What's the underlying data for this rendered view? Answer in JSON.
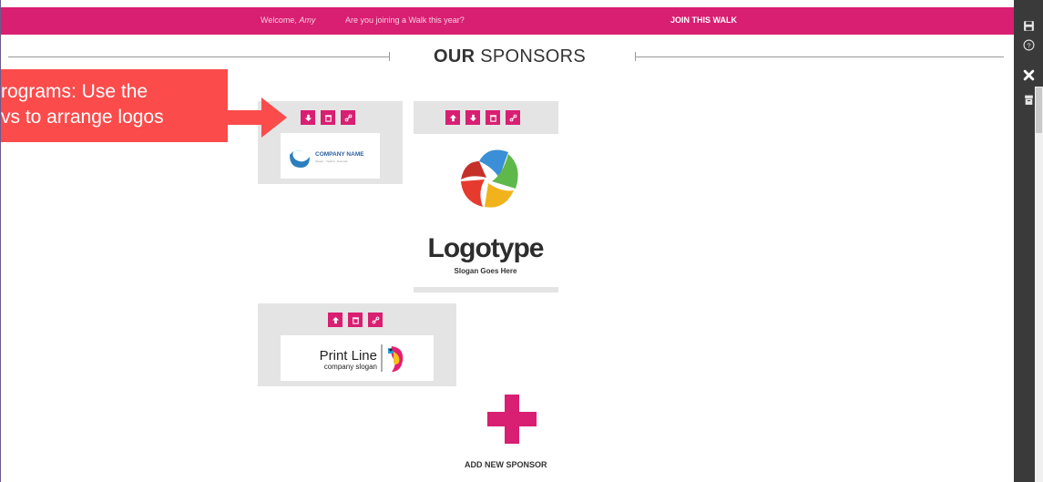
{
  "topbar": {
    "welcome_prefix": "Welcome, ",
    "welcome_name": "Amy",
    "question": "Are you joining a Walk this year?",
    "join_label": "JOIN THIS WALK",
    "color": "#d81f72"
  },
  "heading": {
    "bold": "OUR",
    "regular": " SPONSORS"
  },
  "callout": {
    "line1": "rograms: Use the",
    "line2": "vs to arrange logos",
    "color": "#fb4b4b"
  },
  "sponsors": [
    {
      "controls": [
        "arrow-down-icon",
        "trash-icon",
        "link-icon"
      ],
      "logo_text": "COMPANY NAME",
      "logo_sub": "Slogan · Tagline · Example"
    },
    {
      "controls": [
        "arrow-up-icon",
        "arrow-down-icon",
        "trash-icon",
        "link-icon"
      ],
      "logo_text": "Logotype",
      "logo_sub": "Slogan Goes Here"
    },
    {
      "controls": [
        "arrow-up-icon",
        "trash-icon",
        "link-icon"
      ],
      "logo_text": "Print Line",
      "logo_sub": "company slogan"
    }
  ],
  "add_sponsor": {
    "label": "ADD NEW SPONSOR",
    "icon": "plus-icon"
  },
  "sidebar": {
    "buttons": [
      "save-icon",
      "help-icon",
      "close-icon",
      "archive-icon"
    ]
  }
}
